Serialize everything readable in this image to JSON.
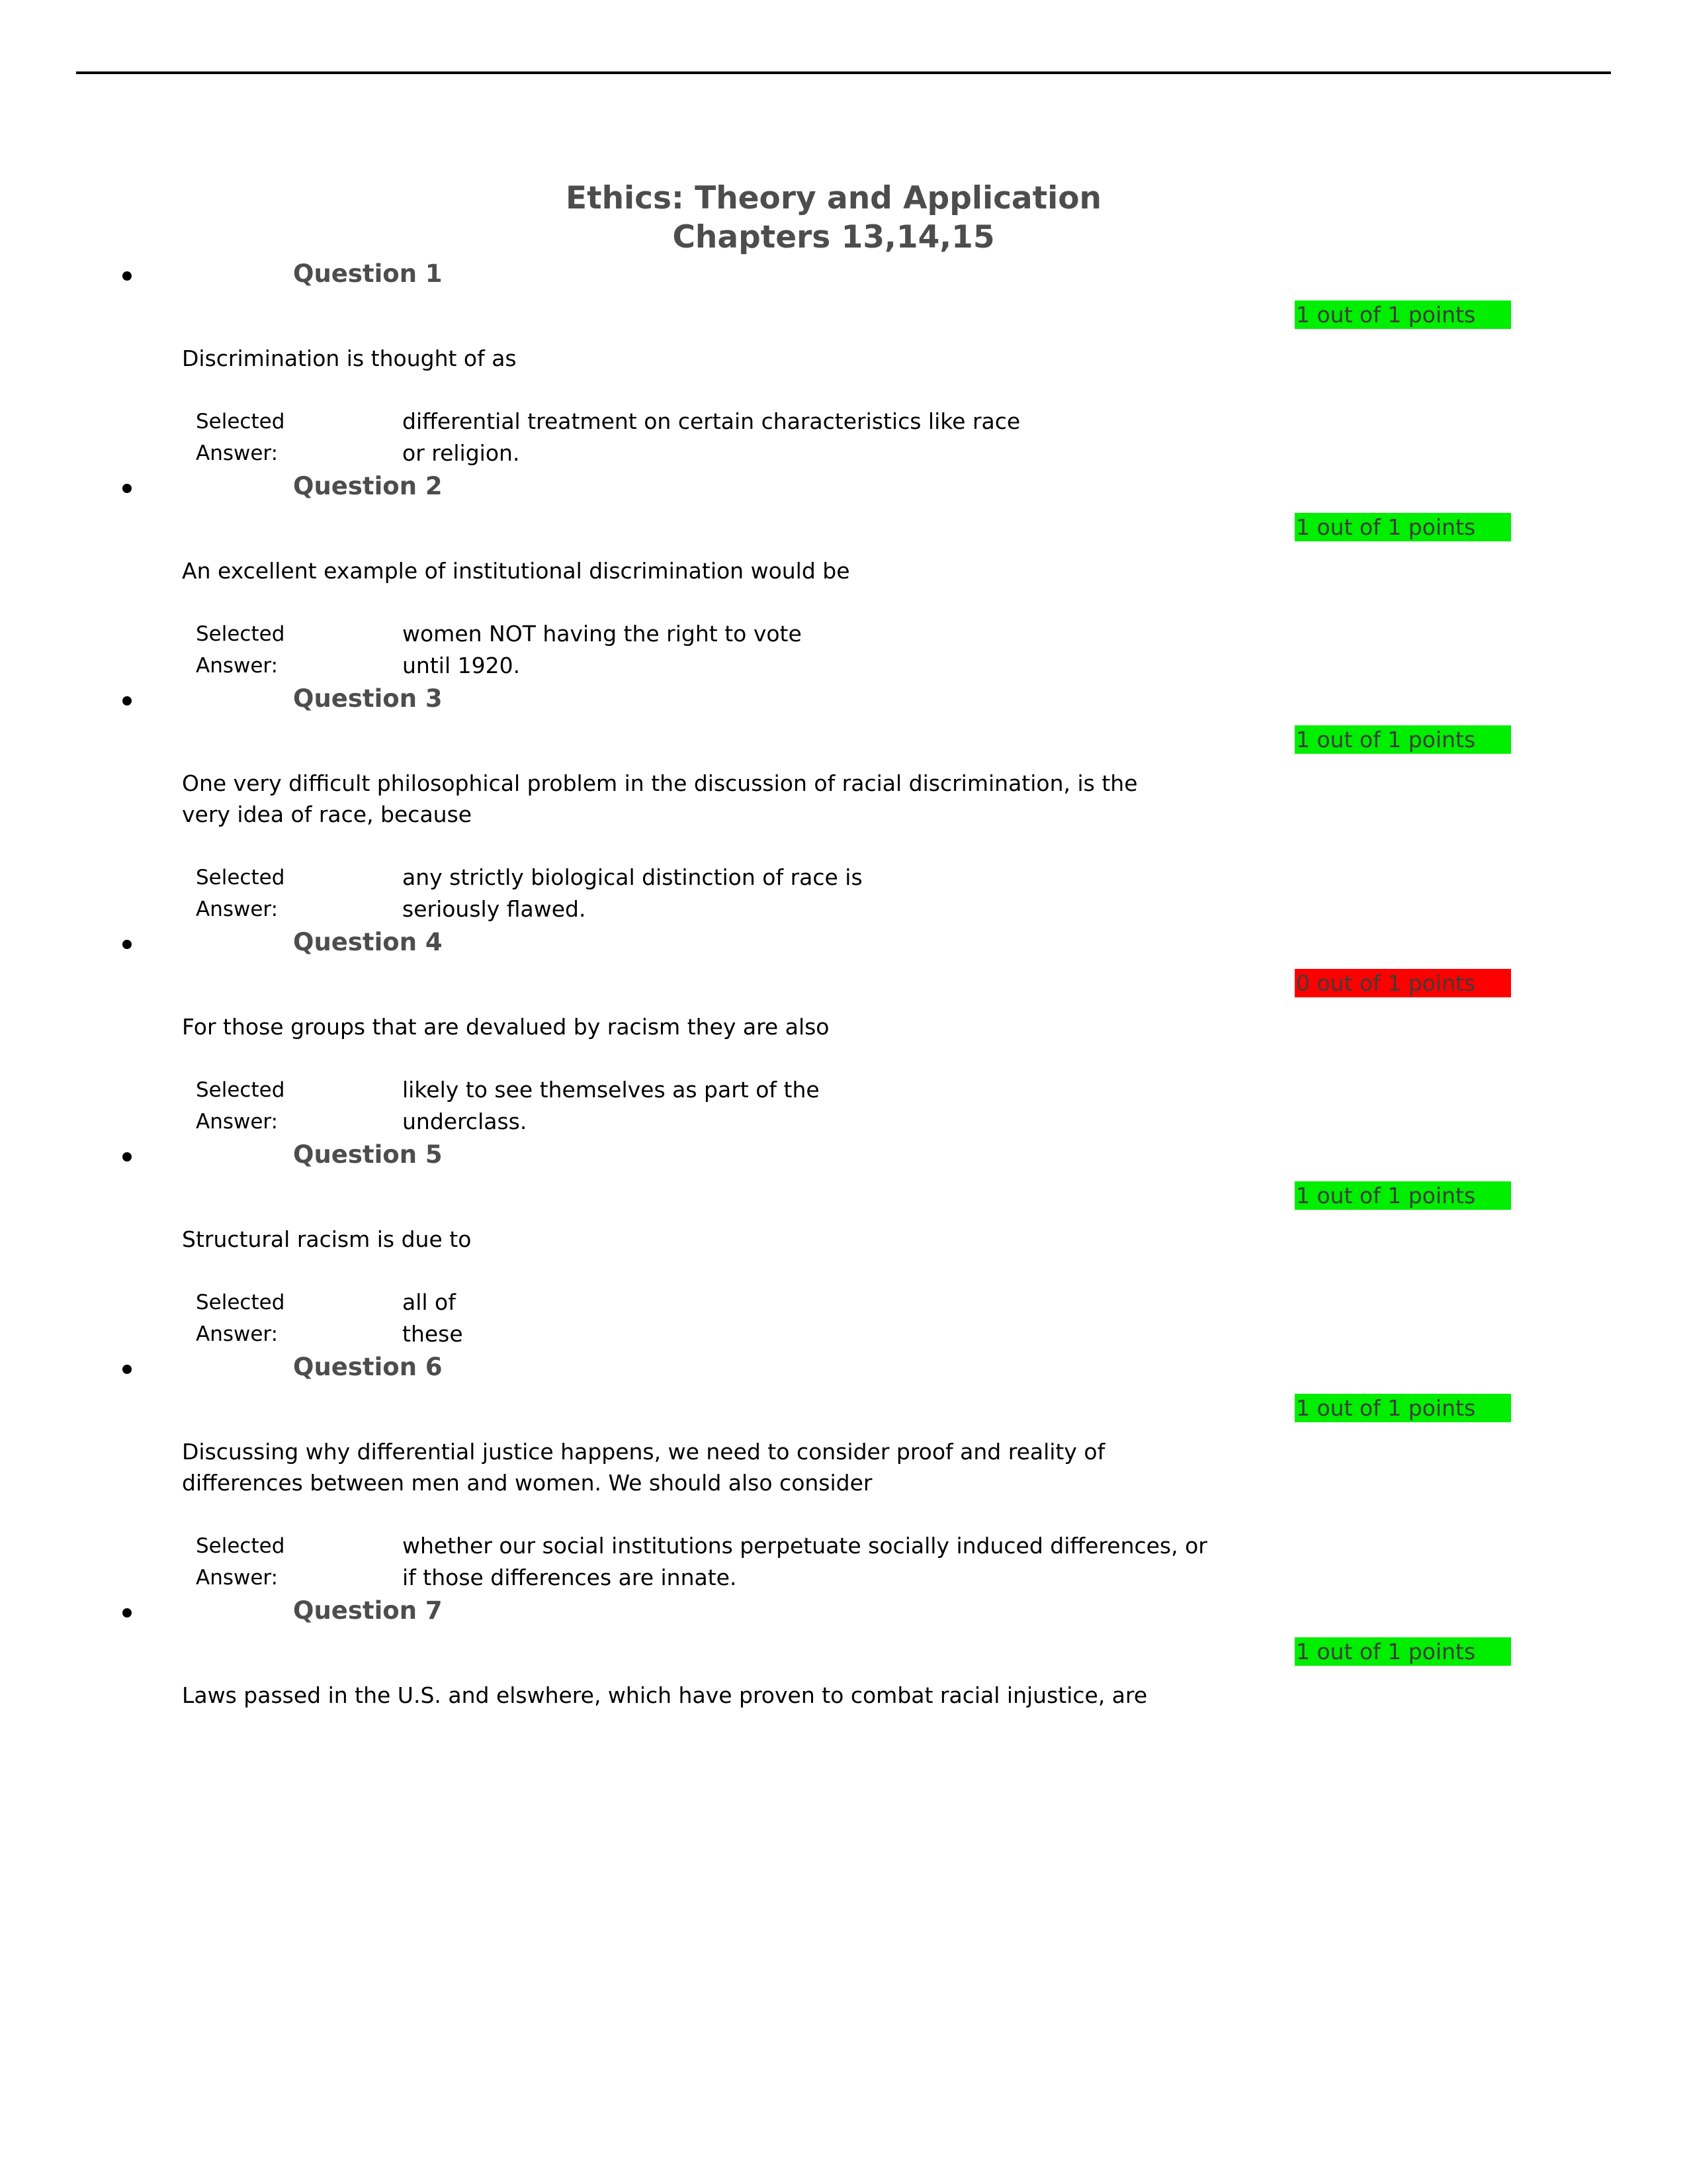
{
  "document": {
    "title_lines": [
      "Ethics: Theory and Application",
      "Chapters 13,14,15"
    ],
    "answer_label_lines": [
      "Selected",
      "Answer:"
    ],
    "colors": {
      "correct_badge": "#00EE00",
      "incorrect_badge": "#FF0000",
      "heading_gray": "#4D4D4D",
      "badge_text": "#3D3D3D",
      "body_text": "#000000",
      "page_background": "#FFFFFF",
      "rule": "#000000"
    }
  },
  "questions": [
    {
      "heading": "Question 1",
      "points": "1 out of 1 points",
      "status": "correct",
      "prompt_lines": [
        "Discrimination is thought of as"
      ],
      "answer_lines": [
        "differential treatment on certain characteristics like race",
        "or religion."
      ]
    },
    {
      "heading": "Question 2",
      "points": "1 out of 1 points",
      "status": "correct",
      "prompt_lines": [
        "An excellent example of institutional discrimination would be"
      ],
      "answer_lines": [
        "women NOT having the right to vote",
        "until 1920."
      ]
    },
    {
      "heading": "Question 3",
      "points": "1 out of 1 points",
      "status": "correct",
      "prompt_lines": [
        "One very difficult philosophical problem in the discussion of racial discrimination, is the",
        "very idea of race, because"
      ],
      "answer_lines": [
        "any strictly biological distinction of race is",
        "seriously flawed."
      ]
    },
    {
      "heading": "Question 4",
      "points": "0 out of 1 points",
      "status": "incorrect",
      "prompt_lines": [
        "For those groups that are devalued by racism they are also"
      ],
      "answer_lines": [
        "likely to see themselves as part of the",
        "underclass."
      ]
    },
    {
      "heading": "Question 5",
      "points": "1 out of 1 points",
      "status": "correct",
      "prompt_lines": [
        "Structural racism is due to"
      ],
      "answer_lines": [
        "all of",
        "these"
      ]
    },
    {
      "heading": "Question 6",
      "points": "1 out of 1 points",
      "status": "correct",
      "prompt_lines": [
        "Discussing why differential justice happens, we need to consider proof and reality of",
        "differences between men and women. We should also consider"
      ],
      "answer_lines": [
        "whether our social institutions perpetuate socially induced differences, or",
        "if those differences are innate."
      ]
    },
    {
      "heading": "Question 7",
      "points": "1 out of 1 points",
      "status": "correct",
      "prompt_lines": [
        "Laws passed in the U.S. and elswhere, which have proven to combat racial injustice, are"
      ],
      "answer_lines": []
    }
  ]
}
